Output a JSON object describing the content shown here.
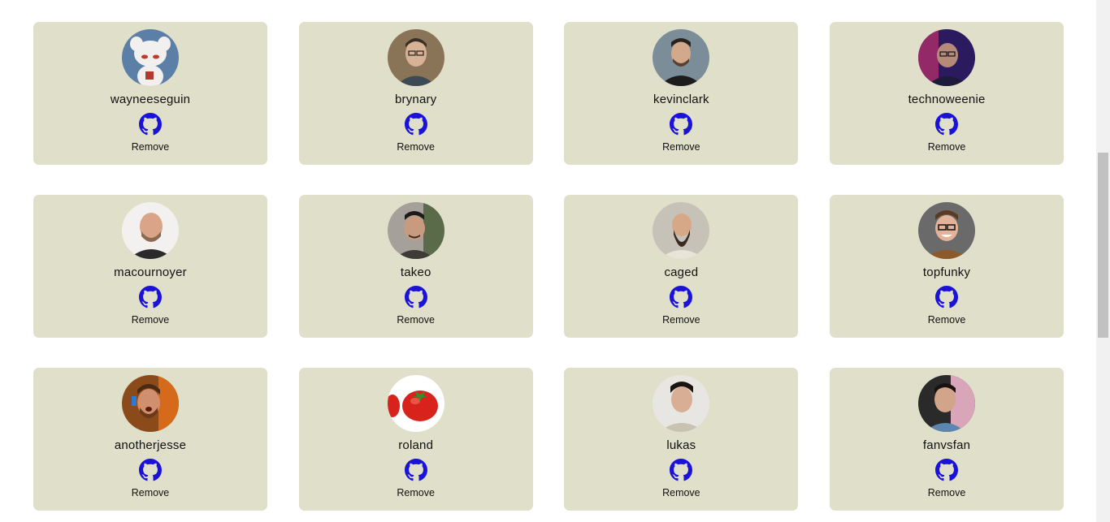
{
  "colors": {
    "card_background": "#e0dfca",
    "github_icon": "#1a12d8",
    "page_background": "#ffffff"
  },
  "cards": [
    {
      "username": "wayneeseguin",
      "remove_label": "Remove",
      "icon": "github-icon",
      "avatar": "cartoon-mouse-avatar"
    },
    {
      "username": "brynary",
      "remove_label": "Remove",
      "icon": "github-icon",
      "avatar": "person-photo-avatar"
    },
    {
      "username": "kevinclark",
      "remove_label": "Remove",
      "icon": "github-icon",
      "avatar": "person-photo-avatar"
    },
    {
      "username": "technoweenie",
      "remove_label": "Remove",
      "icon": "github-icon",
      "avatar": "person-photo-avatar"
    },
    {
      "username": "macournoyer",
      "remove_label": "Remove",
      "icon": "github-icon",
      "avatar": "person-photo-avatar"
    },
    {
      "username": "takeo",
      "remove_label": "Remove",
      "icon": "github-icon",
      "avatar": "person-photo-avatar"
    },
    {
      "username": "caged",
      "remove_label": "Remove",
      "icon": "github-icon",
      "avatar": "person-photo-avatar"
    },
    {
      "username": "topfunky",
      "remove_label": "Remove",
      "icon": "github-icon",
      "avatar": "person-photo-avatar"
    },
    {
      "username": "anotherjesse",
      "remove_label": "Remove",
      "icon": "github-icon",
      "avatar": "person-photo-avatar"
    },
    {
      "username": "roland",
      "remove_label": "Remove",
      "icon": "github-icon",
      "avatar": "tomato-avatar"
    },
    {
      "username": "lukas",
      "remove_label": "Remove",
      "icon": "github-icon",
      "avatar": "person-photo-avatar"
    },
    {
      "username": "fanvsfan",
      "remove_label": "Remove",
      "icon": "github-icon",
      "avatar": "person-photo-avatar"
    }
  ]
}
